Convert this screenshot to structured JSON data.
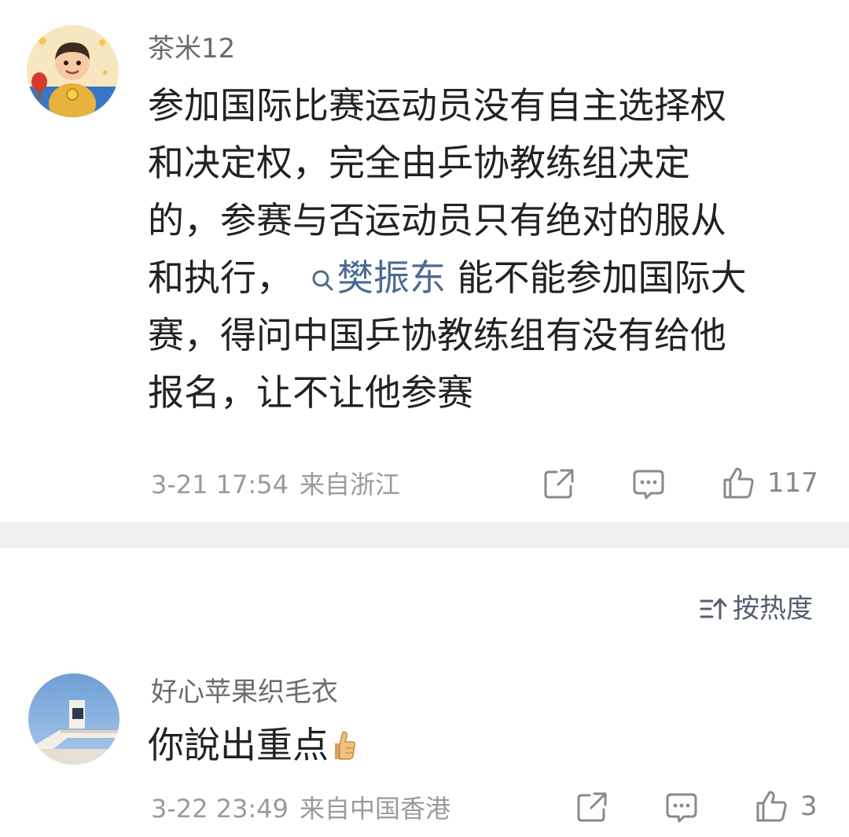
{
  "post": {
    "username": "茶米12",
    "content_lines": [
      "参加国际比赛运动员没有自主选择权",
      "和决定权，完全由乒协教练组决定",
      "的，参赛与否运动员只有绝对的服从"
    ],
    "content_line4_before": "和执行，",
    "mention_name": "樊振东",
    "content_line4_after": " 能不能参加国际大",
    "content_lines_end": [
      "赛，得问中国乒协教练组有没有给他",
      "报名，让不让他参赛"
    ],
    "timestamp": "3-21 17:54",
    "location": "来自浙江",
    "like_count": "117"
  },
  "sort": {
    "label": "按热度"
  },
  "reply": {
    "username": "好心苹果织毛衣",
    "content": "你說出重点",
    "timestamp": "3-22 23:49",
    "location": "来自中国香港",
    "like_count": "3"
  },
  "icons": {
    "share": "share-icon",
    "comment": "comment-icon",
    "like": "like-icon",
    "search": "search-icon",
    "sort": "sort-icon",
    "thumbs_up_emoji": "thumbs-up-emoji-icon"
  },
  "colors": {
    "mention": "#4a6b94",
    "meta_text": "#9a9a9a",
    "divider": "#f0f0f0"
  }
}
